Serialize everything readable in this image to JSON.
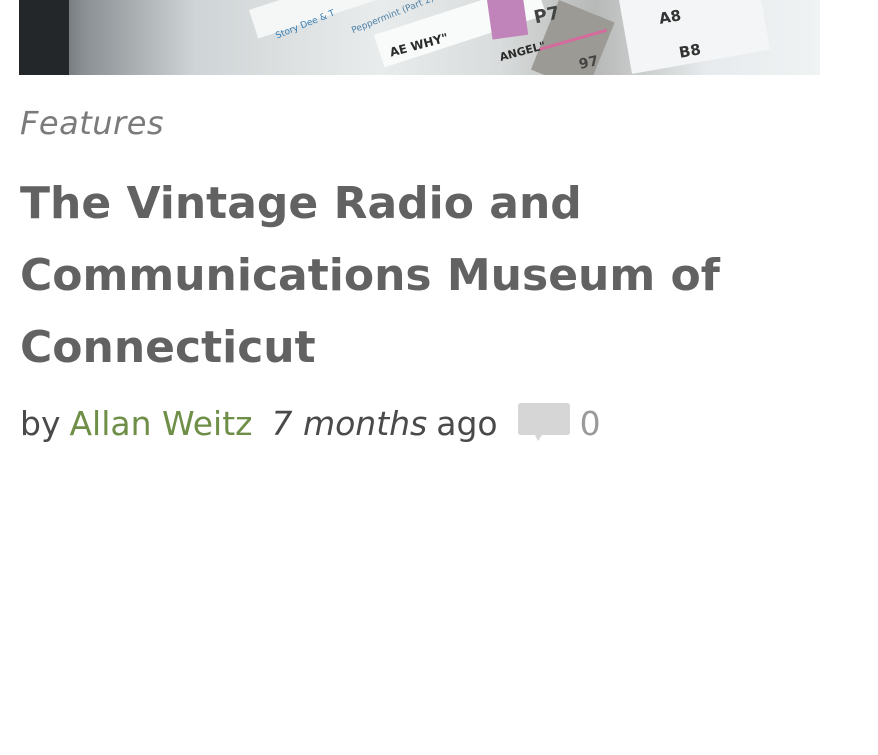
{
  "hero": {
    "image_text": [
      "AE WHY\"",
      "ANGEL\"",
      "P7",
      "A8",
      "B8",
      "97",
      "Story Dee & T",
      "Peppermint (Part 2)"
    ]
  },
  "article": {
    "category": "Features",
    "title": "The Vintage Radio and Communications Museum of Connecticut",
    "byline_prefix": "by",
    "author": "Allan Weitz",
    "time_value": "7 months",
    "time_suffix": "ago",
    "comment_count": "0",
    "comment_icon": "speech-bubble-icon"
  },
  "colors": {
    "title": "#626262",
    "category": "#7b7b7b",
    "author_link": "#6f8f48",
    "comment_icon": "#d6d6d6",
    "comment_count": "#9a9a9a"
  }
}
